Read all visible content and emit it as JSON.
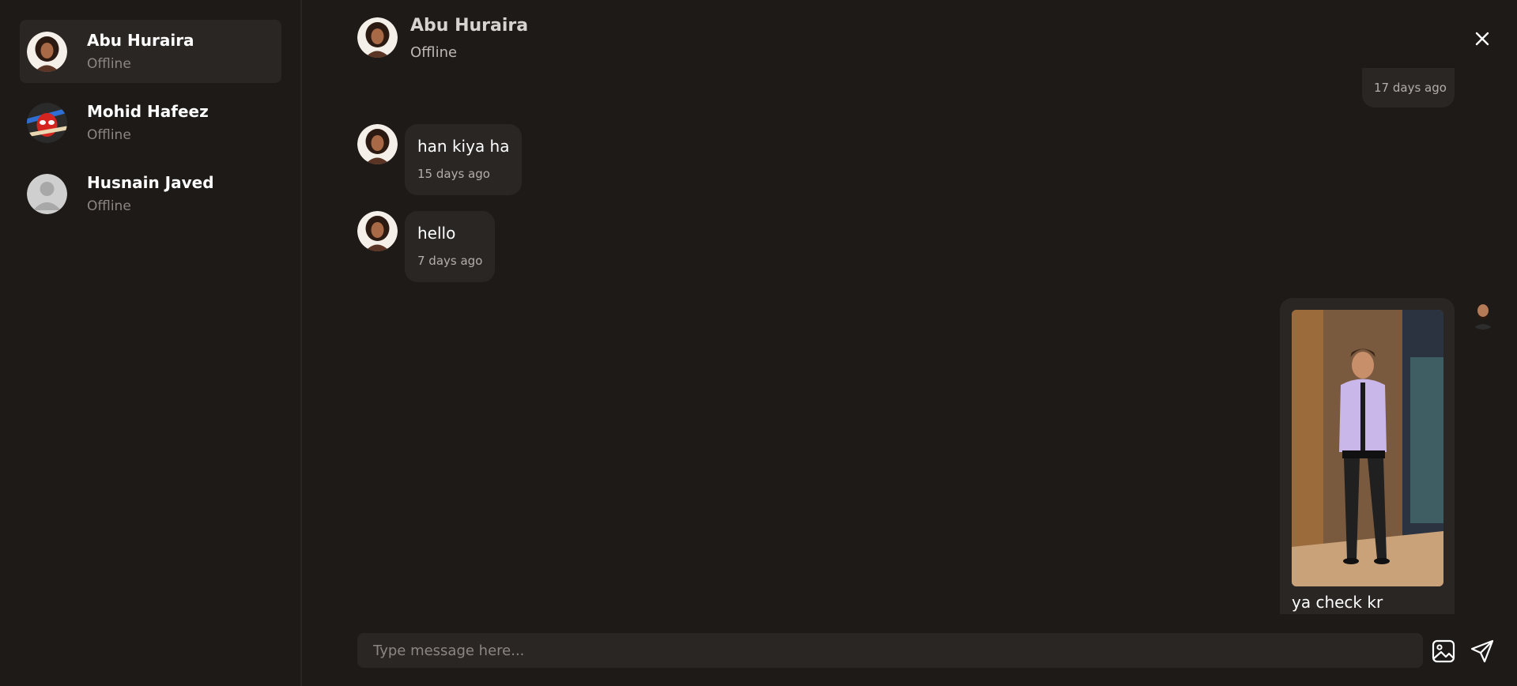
{
  "sidebar": {
    "contacts": [
      {
        "name": "Abu Huraira",
        "status": "Offline"
      },
      {
        "name": "Mohid Hafeez",
        "status": "Offline"
      },
      {
        "name": "Husnain Javed",
        "status": "Offline"
      }
    ]
  },
  "chat": {
    "header": {
      "name": "Abu Huraira",
      "status": "Offline"
    },
    "messages": [
      {
        "text": "",
        "time": "17 days ago"
      },
      {
        "text": "han kiya ha",
        "time": "15 days ago"
      },
      {
        "text": "hello",
        "time": "7 days ago"
      },
      {
        "text": "ya check kr",
        "time": ""
      }
    ]
  },
  "composer": {
    "placeholder": "Type message here..."
  },
  "icons": {
    "close": "close-icon",
    "image": "image-icon",
    "send": "send-icon"
  },
  "colors": {
    "background": "#1e1a17",
    "bubble": "#2a2624",
    "active_contact": "#2a2624"
  }
}
